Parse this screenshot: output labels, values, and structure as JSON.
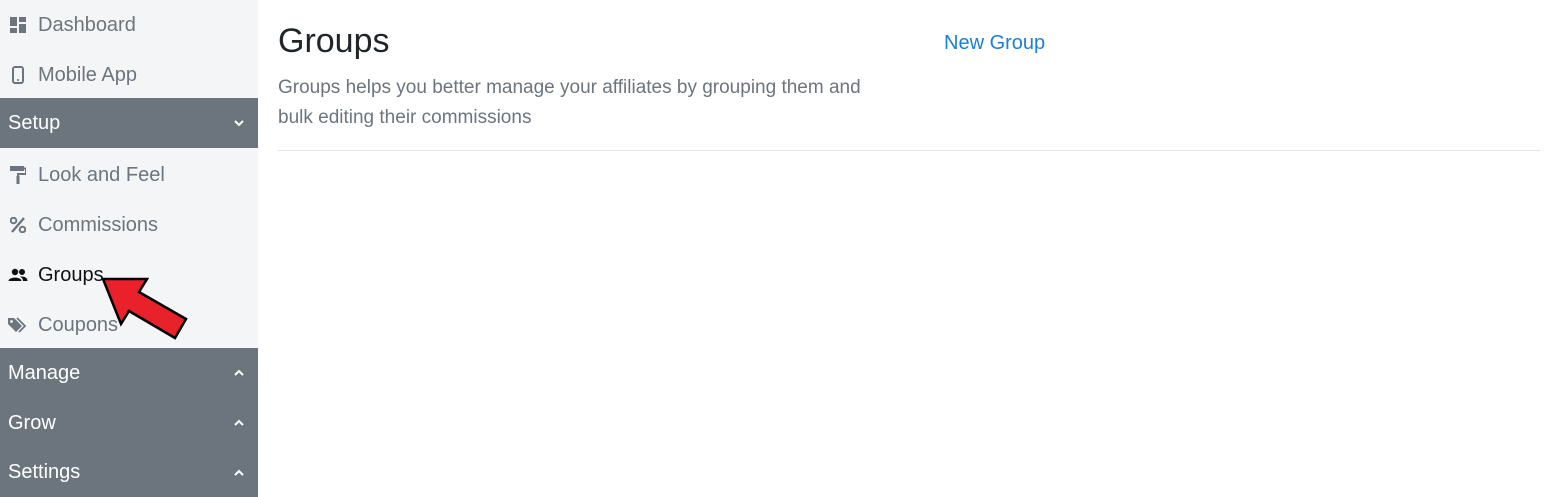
{
  "sidebar": {
    "items_top": [
      {
        "label": "Dashboard",
        "icon": "dashboard-icon"
      },
      {
        "label": "Mobile App",
        "icon": "mobile-icon"
      }
    ],
    "sections": {
      "setup": {
        "label": "Setup",
        "expanded": true
      },
      "manage": {
        "label": "Manage",
        "expanded": false
      },
      "grow": {
        "label": "Grow",
        "expanded": false
      },
      "settings": {
        "label": "Settings",
        "expanded": false
      }
    },
    "setup_items": [
      {
        "label": "Look and Feel",
        "icon": "paint-roller-icon"
      },
      {
        "label": "Commissions",
        "icon": "percent-icon"
      },
      {
        "label": "Groups",
        "icon": "users-icon",
        "active": true
      },
      {
        "label": "Coupons",
        "icon": "tags-icon"
      }
    ]
  },
  "main": {
    "title": "Groups",
    "new_group_label": "New Group",
    "description": "Groups helps you better manage your affiliates by grouping them and bulk editing their commissions"
  },
  "annotation": {
    "type": "arrow",
    "target": "Groups",
    "color": "#e8212b"
  },
  "colors": {
    "sidebar_bg": "#f4f5f7",
    "section_bg": "#6c757d",
    "link": "#1a7fd6",
    "muted_text": "#6c757d"
  }
}
